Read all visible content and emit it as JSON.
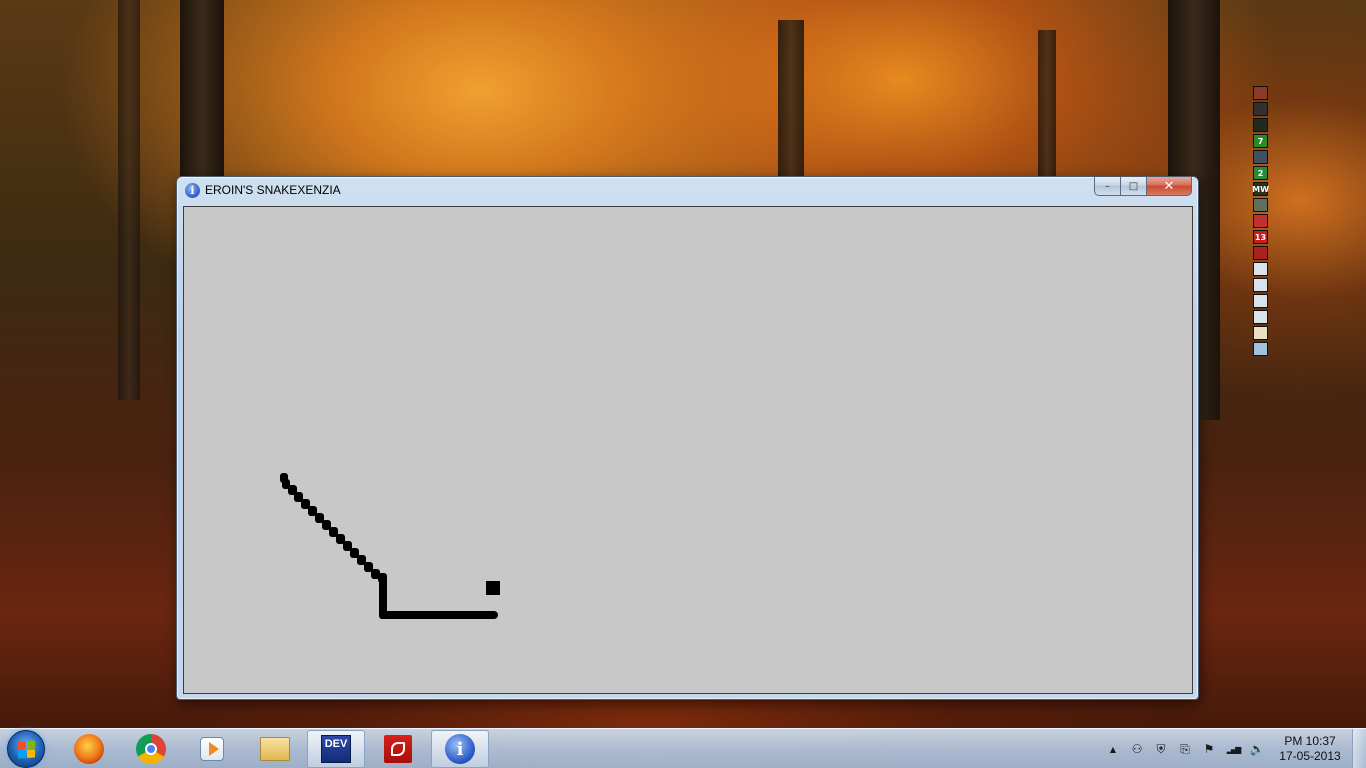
{
  "window": {
    "title": "EROIN'S SNAKEXENZIA",
    "icon": "info-icon",
    "minimize_glyph": "–",
    "maximize_glyph": "□",
    "close_glyph": "✕"
  },
  "game": {
    "background_color": "#c8c8c8",
    "snake_color": "#000000",
    "food_color": "#000000",
    "snake_trail": "diagonal from upper-left down to corner, then horizontal right",
    "food": "square pellet near snake head"
  },
  "desktop_icons": [
    {
      "name": "game-icon-1",
      "label": "",
      "color": "#8a3a2a"
    },
    {
      "name": "game-icon-2",
      "label": "",
      "color": "#303030"
    },
    {
      "name": "game-icon-3",
      "label": "",
      "color": "#202a20"
    },
    {
      "name": "game-icon-4",
      "label": "7",
      "color": "#2a8a2a"
    },
    {
      "name": "game-icon-5",
      "label": "",
      "color": "#405060"
    },
    {
      "name": "game-icon-6",
      "label": "2",
      "color": "#2a8a3a"
    },
    {
      "name": "game-icon-7",
      "label": "MW",
      "color": "#2a3020"
    },
    {
      "name": "game-icon-8",
      "label": "",
      "color": "#607060"
    },
    {
      "name": "game-icon-9",
      "label": "",
      "color": "#c03030"
    },
    {
      "name": "game-icon-10",
      "label": "13",
      "color": "#c02020"
    },
    {
      "name": "game-icon-11",
      "label": "",
      "color": "#a82020"
    },
    {
      "name": "file-icon-1",
      "label": "",
      "color": "#d8e4ec"
    },
    {
      "name": "file-icon-2",
      "label": "",
      "color": "#d8e4ec"
    },
    {
      "name": "file-icon-3",
      "label": "",
      "color": "#d8e4ec"
    },
    {
      "name": "file-icon-4",
      "label": "",
      "color": "#d8e4ec"
    },
    {
      "name": "shortcut-icon",
      "label": "",
      "color": "#e8e0c0"
    },
    {
      "name": "recycle-bin-icon",
      "label": "",
      "color": "#a0c4e0"
    }
  ],
  "taskbar": {
    "pinned": [
      {
        "name": "firefox-icon",
        "label": ""
      },
      {
        "name": "chrome-icon",
        "label": ""
      },
      {
        "name": "media-player-icon",
        "label": ""
      },
      {
        "name": "file-explorer-icon",
        "label": ""
      },
      {
        "name": "devcpp-icon",
        "label": "DEV"
      },
      {
        "name": "adobe-reader-icon",
        "label": ""
      },
      {
        "name": "info-app-icon",
        "label": "i"
      }
    ],
    "tray": [
      {
        "name": "show-hidden-icons-icon",
        "glyph": "▲"
      },
      {
        "name": "network-user-icon",
        "glyph": "⚇"
      },
      {
        "name": "antivirus-shield-icon",
        "glyph": "⛨"
      },
      {
        "name": "usb-device-icon",
        "glyph": "⎘"
      },
      {
        "name": "action-center-flag-icon",
        "glyph": "⚑"
      },
      {
        "name": "signal-bars-icon",
        "glyph": "▂▄▆"
      },
      {
        "name": "volume-icon",
        "glyph": "🔈"
      }
    ],
    "clock_time": "PM 10:37",
    "clock_date": "17-05-2013"
  }
}
